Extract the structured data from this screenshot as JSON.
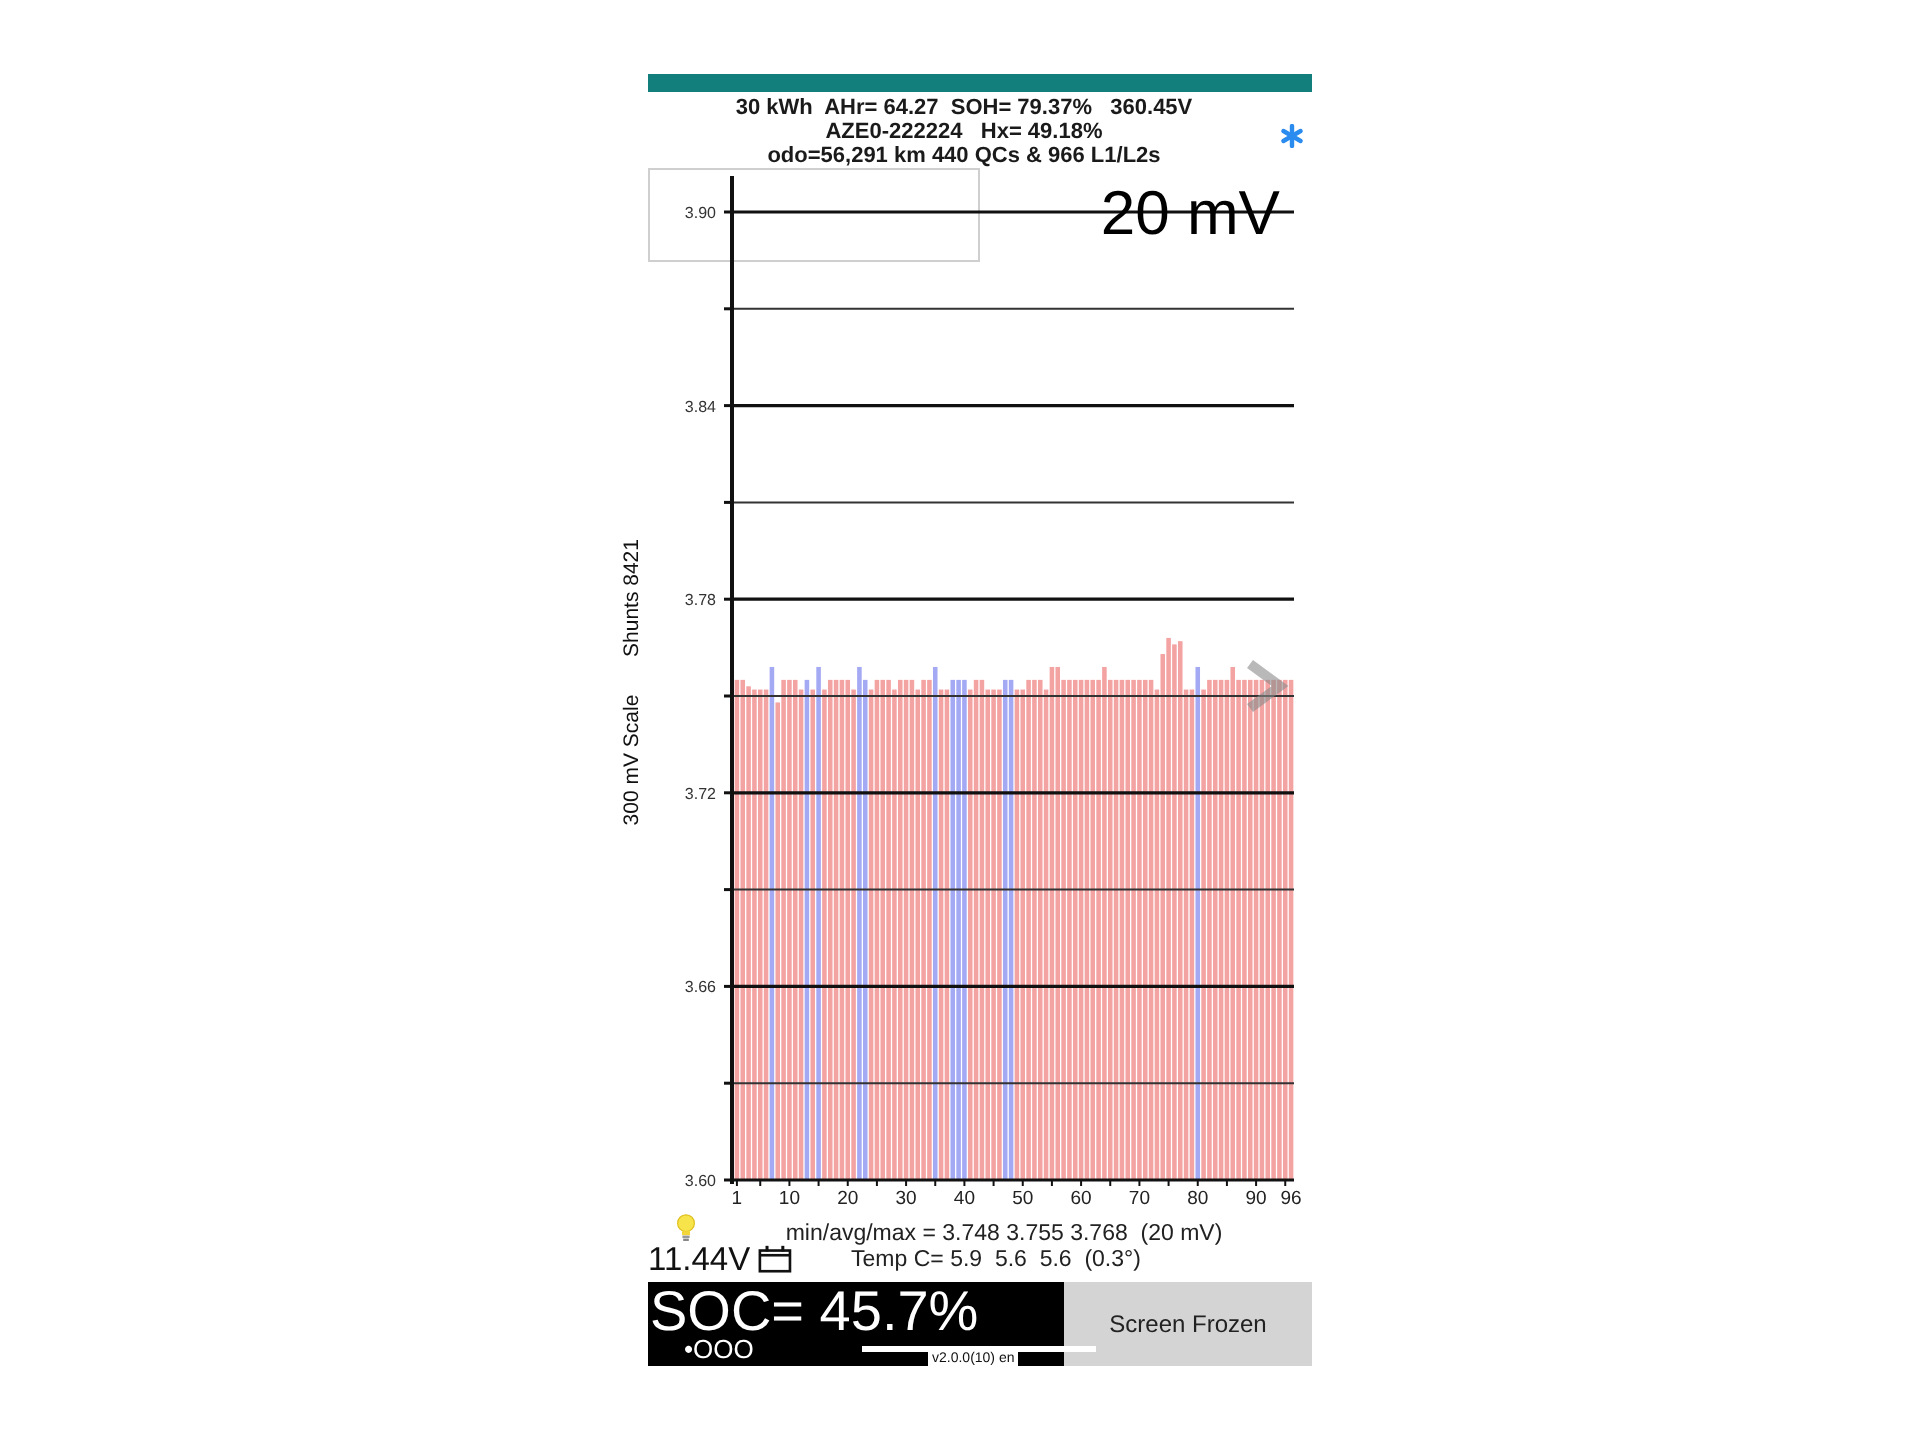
{
  "header": {
    "lines": [
      "30 kWh  AHr= 64.27  SOH= 79.37%   360.45V",
      "AZE0-222224   Hx= 49.18%",
      "odo=56,291 km 440 QCs & 966 L1/L2s"
    ]
  },
  "chart": {
    "scale_label": "20 mV",
    "shunts_label": "Shunts 8421",
    "chart_data": {
      "type": "bar",
      "ylabel": "300 mV Scale",
      "grid": true,
      "ylim": [
        3.6,
        3.9
      ],
      "yticks": [
        {
          "value": 3.6,
          "label": "3.60"
        },
        {
          "value": 3.66,
          "label": "3.66"
        },
        {
          "value": 3.72,
          "label": "3.72"
        },
        {
          "value": 3.78,
          "label": "3.78"
        },
        {
          "value": 3.84,
          "label": "3.84"
        },
        {
          "value": 3.9,
          "label": "3.90"
        }
      ],
      "categories": [
        "1",
        null,
        null,
        null,
        null,
        null,
        null,
        null,
        null,
        "10",
        null,
        null,
        null,
        null,
        null,
        null,
        null,
        null,
        null,
        "20",
        null,
        null,
        null,
        null,
        null,
        null,
        null,
        null,
        null,
        "30",
        null,
        null,
        null,
        null,
        null,
        null,
        null,
        null,
        null,
        "40",
        null,
        null,
        null,
        null,
        null,
        null,
        null,
        null,
        null,
        "50",
        null,
        null,
        null,
        null,
        null,
        null,
        null,
        null,
        null,
        "60",
        null,
        null,
        null,
        null,
        null,
        null,
        null,
        null,
        null,
        "70",
        null,
        null,
        null,
        null,
        null,
        null,
        null,
        null,
        null,
        "80",
        null,
        null,
        null,
        null,
        null,
        null,
        null,
        null,
        null,
        "90",
        null,
        null,
        null,
        null,
        null,
        "96"
      ],
      "series": [
        {
          "color": "#f4a3a3",
          "values": [
            3.755,
            3.755,
            3.753,
            3.752,
            3.752,
            3.752,
            null,
            3.748,
            3.755,
            3.755,
            3.755,
            3.752,
            null,
            3.752,
            null,
            3.752,
            3.755,
            3.755,
            3.755,
            3.755,
            3.752,
            null,
            null,
            3.752,
            3.755,
            3.755,
            3.755,
            3.752,
            3.755,
            3.755,
            3.755,
            3.752,
            3.755,
            3.755,
            null,
            3.752,
            3.752,
            null,
            null,
            null,
            3.752,
            3.755,
            3.755,
            3.752,
            3.752,
            3.752,
            null,
            null,
            3.752,
            3.752,
            3.755,
            3.755,
            3.755,
            3.752,
            3.759,
            3.759,
            3.755,
            3.755,
            3.755,
            3.755,
            3.755,
            3.755,
            3.755,
            3.759,
            3.755,
            3.755,
            3.755,
            3.755,
            3.755,
            3.755,
            3.755,
            3.755,
            3.752,
            3.763,
            3.768,
            3.766,
            3.767,
            3.752,
            3.752,
            null,
            3.752,
            3.755,
            3.755,
            3.755,
            3.755,
            3.759,
            3.755,
            3.755,
            3.755,
            3.755,
            3.755,
            3.755,
            3.755,
            3.755,
            3.755,
            3.755
          ]
        },
        {
          "color": "#a4a9f4",
          "values": [
            null,
            null,
            null,
            null,
            null,
            null,
            3.759,
            null,
            null,
            null,
            null,
            null,
            3.755,
            null,
            3.759,
            null,
            null,
            null,
            null,
            null,
            null,
            3.759,
            3.755,
            null,
            null,
            null,
            null,
            null,
            null,
            null,
            null,
            null,
            null,
            null,
            3.759,
            null,
            null,
            3.755,
            3.755,
            3.755,
            null,
            null,
            null,
            null,
            null,
            null,
            3.755,
            3.755,
            null,
            null,
            null,
            null,
            null,
            null,
            null,
            null,
            null,
            null,
            null,
            null,
            null,
            null,
            null,
            null,
            null,
            null,
            null,
            null,
            null,
            null,
            null,
            null,
            null,
            null,
            null,
            null,
            null,
            null,
            null,
            3.759,
            null,
            null,
            null,
            null,
            null,
            null,
            null,
            null,
            null,
            null,
            null,
            null,
            null,
            null,
            null,
            null
          ]
        }
      ]
    }
  },
  "stats": {
    "min_avg_max": "min/avg/max = 3.748 3.755 3.768  (20 mV)",
    "aux_voltage": "11.44V",
    "temperature": "Temp C= 5.9  5.6  5.6  (0.3°)"
  },
  "bottom_bar": {
    "soc": "SOC= 45.7%",
    "page_dots": "•OOO",
    "button": "Screen Frozen",
    "version": "v2.0.0(10) en"
  }
}
